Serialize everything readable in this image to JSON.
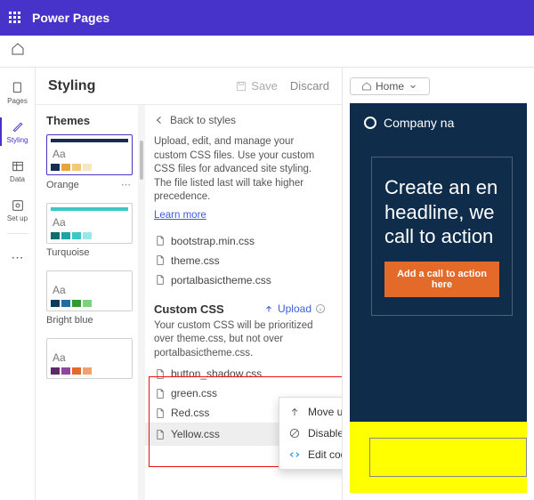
{
  "topbar": {
    "app_title": "Power Pages"
  },
  "rail": {
    "pages": "Pages",
    "styling": "Styling",
    "data": "Data",
    "setup": "Set up"
  },
  "styling": {
    "title": "Styling",
    "save": "Save",
    "discard": "Discard"
  },
  "themes": {
    "heading": "Themes",
    "cards": [
      {
        "label": "Orange"
      },
      {
        "label": "Turquoise"
      },
      {
        "label": "Bright blue"
      },
      {
        "label": ""
      }
    ]
  },
  "cssPanel": {
    "back": "Back to styles",
    "desc": "Upload, edit, and manage your custom CSS files. Use your custom CSS files for advanced site styling. The file listed last will take higher precedence.",
    "learn": "Learn more",
    "base_files": [
      "bootstrap.min.css",
      "theme.css",
      "portalbasictheme.css"
    ],
    "custom_heading": "Custom CSS",
    "upload": "Upload",
    "custom_desc": "Your custom CSS will be prioritized over theme.css, but not over portalbasictheme.css.",
    "custom_files": [
      "button_shadow.css",
      "green.css",
      "Red.css",
      "Yellow.css"
    ]
  },
  "contextMenu": {
    "moveup": "Move up",
    "disable": "Disable",
    "editcode": "Edit code"
  },
  "preview": {
    "breadcrumb_home": "Home",
    "company": "Company na",
    "hero": "Create an en\nheadline, we\ncall to action",
    "cta": "Add a call to action here"
  }
}
